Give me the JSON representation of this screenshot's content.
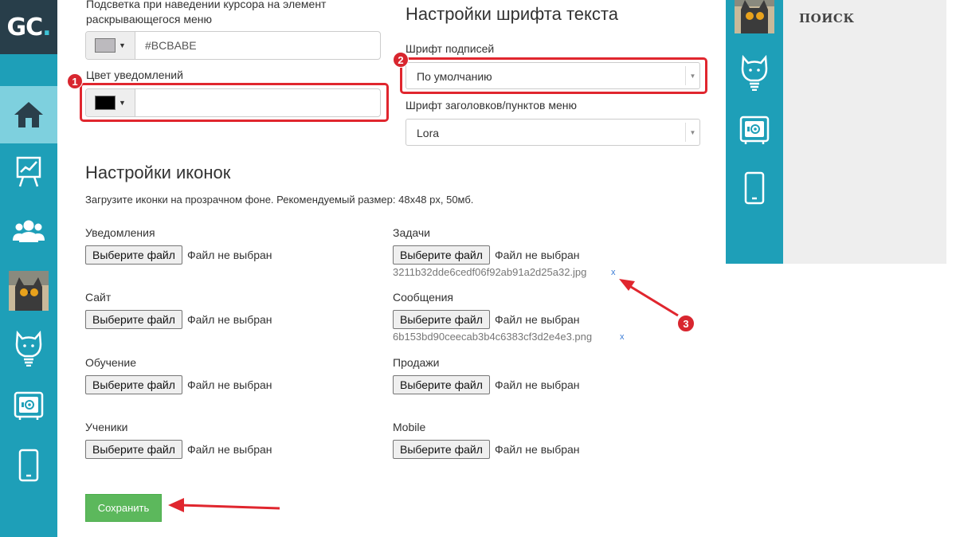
{
  "logo": {
    "text": "GC",
    "dot": "."
  },
  "sidebar": {
    "items": [
      {
        "icon": "home-icon",
        "active": true
      },
      {
        "icon": "chart-board-icon"
      },
      {
        "icon": "users-icon"
      },
      {
        "icon": "avatar-cat"
      },
      {
        "icon": "cat-lightbulb-icon"
      },
      {
        "icon": "safe-icon"
      },
      {
        "icon": "mobile-icon"
      }
    ]
  },
  "right_panel": {
    "search_label": "ПОИСК"
  },
  "colors_section": {
    "hover_label": "Подсветка при наведении курсора на элемент раскрывающегося меню",
    "hover_value": "#BCBABE",
    "hover_swatch": "#bcbabe",
    "notify_label": "Цвет уведомлений",
    "notify_value": "",
    "notify_swatch": "#000000"
  },
  "font_section": {
    "heading": "Настройки шрифта текста",
    "captions_label": "Шрифт подписей",
    "captions_value": "По умолчанию",
    "headers_label": "Шрифт заголовков/пунктов меню",
    "headers_value": "Lora"
  },
  "icons_section": {
    "heading": "Настройки иконок",
    "hint": "Загрузите иконки на прозрачном фоне. Рекомендуемый размер: 48x48 px, 50мб.",
    "button_label": "Выберите файл",
    "no_file": "Файл не выбран",
    "remove": "x",
    "fields": [
      {
        "label": "Уведомления"
      },
      {
        "label": "Задачи",
        "file": "3211b32dde6cedf06f92ab91a2d25a32.jpg"
      },
      {
        "label": "Сайт"
      },
      {
        "label": "Сообщения",
        "file": "6b153bd90ceecab3b4c6383cf3d2e4e3.png"
      },
      {
        "label": "Обучение"
      },
      {
        "label": "Продажи"
      },
      {
        "label": "Ученики"
      },
      {
        "label": "Mobile"
      }
    ]
  },
  "save_label": "Сохранить",
  "annotations": {
    "n1": "1",
    "n2": "2",
    "n3": "3"
  }
}
